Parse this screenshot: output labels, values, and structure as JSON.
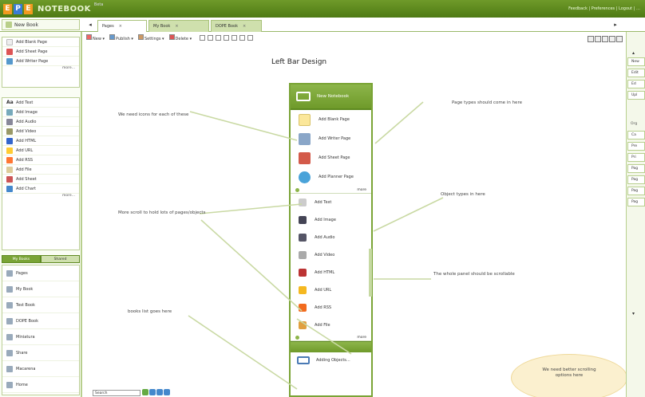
{
  "app": {
    "logo_letters": [
      "E",
      "P",
      "E"
    ],
    "logo_word": "NOTEBOOK",
    "logo_beta": "Beta",
    "top_right": "Feedback | Preferences | Logout | …"
  },
  "tabs": {
    "new_book": "New Book",
    "items": [
      {
        "label": "Pages",
        "active": true
      },
      {
        "label": "My Book",
        "active": false
      },
      {
        "label": "DOPE Book",
        "active": false
      }
    ]
  },
  "toolbar": {
    "items": [
      "New ▾",
      "Publish ▾",
      "Settings ▾",
      "Delete ▾"
    ]
  },
  "sidebar": {
    "pages": [
      "Add Blank Page",
      "Add Sheet Page",
      "Add Writer Page"
    ],
    "pages_more": "more...",
    "objects": [
      "Add Text",
      "Add Image",
      "Add Audio",
      "Add Video",
      "Add HTML",
      "Add URL",
      "Add RSS",
      "Add File",
      "Add Sheet",
      "Add Chart"
    ],
    "objects_more": "more...",
    "tab_active": "My Books",
    "tab_inactive": "Shared",
    "books": [
      "Pages",
      "My Book",
      "Test Book",
      "DOPE Book",
      "Miniatura",
      "Share",
      "Macarena",
      "Home"
    ],
    "search_value": "Search"
  },
  "canvas": {
    "title": "Left Bar Design",
    "mock": {
      "header": "New Notebook",
      "pages": [
        "Add Blank Page",
        "Add Writer Page",
        "Add Sheet Page",
        "Add Planner Page"
      ],
      "pages_more": "more",
      "objects": [
        "Add Text",
        "Add Image",
        "Add Audio",
        "Add Video",
        "Add HTML",
        "Add URL",
        "Add RSS",
        "Add File"
      ],
      "objects_more": "more",
      "footer": "Adding Objects..."
    },
    "notes": {
      "icons": "We need icons for each of these",
      "page_types": "Page types should come in here",
      "object_types": "Object types in here",
      "more_scroll": "More scroll to hold lots of pages/objects",
      "scrollable": "The whole panel should be scrollable",
      "books": "books list goes here",
      "bubble": "We need better scrolling options here"
    }
  },
  "right": {
    "buttons_top": [
      "New",
      "Edit",
      "Ed",
      "Upl"
    ],
    "header": "Org",
    "buttons_bottom": [
      "Ca",
      "Pre",
      "Pri",
      "Pag",
      "Pag",
      "Pag",
      "Pag"
    ]
  },
  "colors": {
    "brand_green": "#6f9a2a",
    "logo_orange": "#f39a1f",
    "logo_blue": "#3a7bd5",
    "bubble": "#fbf0cf"
  }
}
